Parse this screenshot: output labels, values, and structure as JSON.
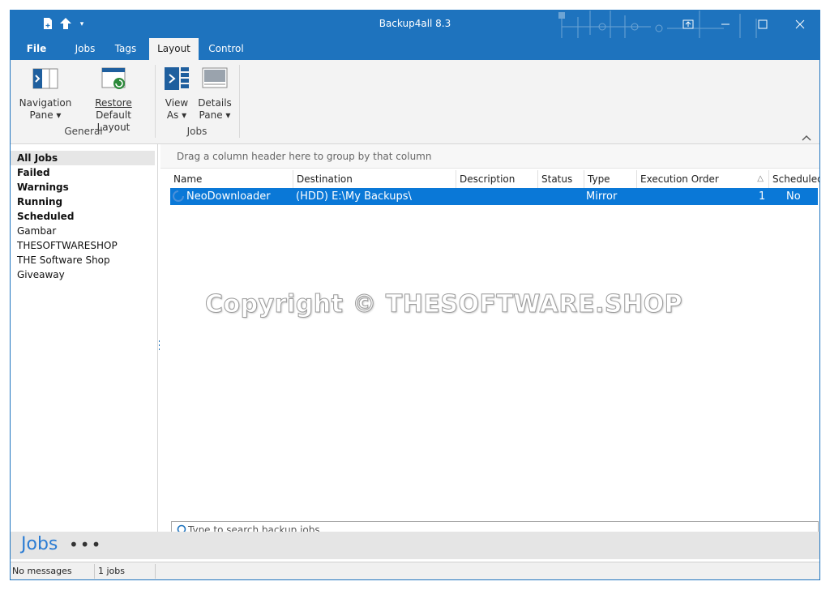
{
  "window": {
    "title": "Backup4all 8.3"
  },
  "tabs": [
    {
      "label": "File",
      "active": false
    },
    {
      "label": "Jobs",
      "active": false
    },
    {
      "label": "Tags",
      "active": false
    },
    {
      "label": "Layout",
      "active": true
    },
    {
      "label": "Control",
      "active": false
    }
  ],
  "ribbon": {
    "general": {
      "label": "General",
      "nav_pane": {
        "line1": "Navigation",
        "line2": "Pane ▾"
      },
      "restore": {
        "line1": "Restore",
        "line2": "Default Layout"
      }
    },
    "jobs": {
      "label": "Jobs",
      "view_as": {
        "line1": "View",
        "line2": "As ▾"
      },
      "details": {
        "line1": "Details",
        "line2": "Pane ▾"
      }
    }
  },
  "nav": {
    "items": [
      {
        "label": "All Jobs",
        "bold": true,
        "selected": true
      },
      {
        "label": "Failed",
        "bold": true,
        "selected": false
      },
      {
        "label": "Warnings",
        "bold": true,
        "selected": false
      },
      {
        "label": "Running",
        "bold": true,
        "selected": false
      },
      {
        "label": "Scheduled",
        "bold": true,
        "selected": false
      },
      {
        "label": "Gambar",
        "bold": false,
        "selected": false
      },
      {
        "label": "THESOFTWARESHOP",
        "bold": false,
        "selected": false
      },
      {
        "label": "THE Software Shop Giveaway",
        "bold": false,
        "selected": false
      }
    ]
  },
  "grid": {
    "group_hint": "Drag a column header here to group by that column",
    "columns": [
      "Name",
      "Destination",
      "Description",
      "Status",
      "Type",
      "Execution Order",
      "Scheduled"
    ],
    "sort_indicator": "△",
    "rows": [
      {
        "name": "NeoDownloader",
        "destination": "(HDD) E:\\My Backups\\",
        "description": "",
        "status": "",
        "type": "Mirror",
        "execution_order": "1",
        "scheduled": "No"
      }
    ]
  },
  "watermark": "Copyright © THESOFTWARE.SHOP",
  "search": {
    "placeholder": "Type to search backup jobs"
  },
  "footer": {
    "section": "Jobs",
    "more": "•••"
  },
  "status": {
    "messages": "No messages",
    "count": "1 jobs"
  },
  "colors": {
    "accent": "#1e73be",
    "selection": "#0a78d7",
    "ribbon_bg": "#f3f3f3"
  }
}
